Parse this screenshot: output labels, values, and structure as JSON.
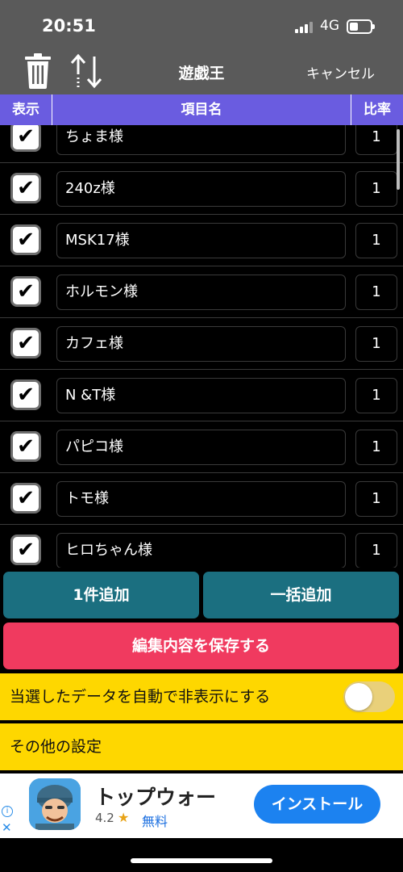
{
  "status": {
    "time": "20:51",
    "network": "4G"
  },
  "nav": {
    "title": "遊戯王",
    "cancel_label": "キャンセル"
  },
  "table_header": {
    "show": "表示",
    "name": "項目名",
    "rate": "比率"
  },
  "rows": [
    {
      "name": "ちょま様",
      "rate": "1",
      "checked": true
    },
    {
      "name": "240z様",
      "rate": "1",
      "checked": true
    },
    {
      "name": "MSK17様",
      "rate": "1",
      "checked": true
    },
    {
      "name": "ホルモン様",
      "rate": "1",
      "checked": true
    },
    {
      "name": "カフェ様",
      "rate": "1",
      "checked": true
    },
    {
      "name": "N &T様",
      "rate": "1",
      "checked": true
    },
    {
      "name": "パピコ様",
      "rate": "1",
      "checked": true
    },
    {
      "name": "トモ様",
      "rate": "1",
      "checked": true
    },
    {
      "name": "ヒロちゃん様",
      "rate": "1",
      "checked": true
    }
  ],
  "check_glyph": "✔",
  "buttons": {
    "add_one": "1件追加",
    "bulk_add": "一括追加",
    "save": "編集内容を保存する"
  },
  "settings": {
    "auto_hide_label": "当選したデータを自動で非表示にする",
    "auto_hide_on": false,
    "other_label": "その他の設定"
  },
  "ad": {
    "title": "トップウォー",
    "rating": "4.2",
    "star": "★",
    "price": "無料",
    "install_label": "インストール",
    "info_glyph": "i",
    "close_glyph": "✕"
  },
  "colors": {
    "header_bg": "#6a5ce0",
    "add_buttons": "#1b6f80",
    "save_button": "#f03a5f",
    "settings_bg": "#fed700"
  }
}
